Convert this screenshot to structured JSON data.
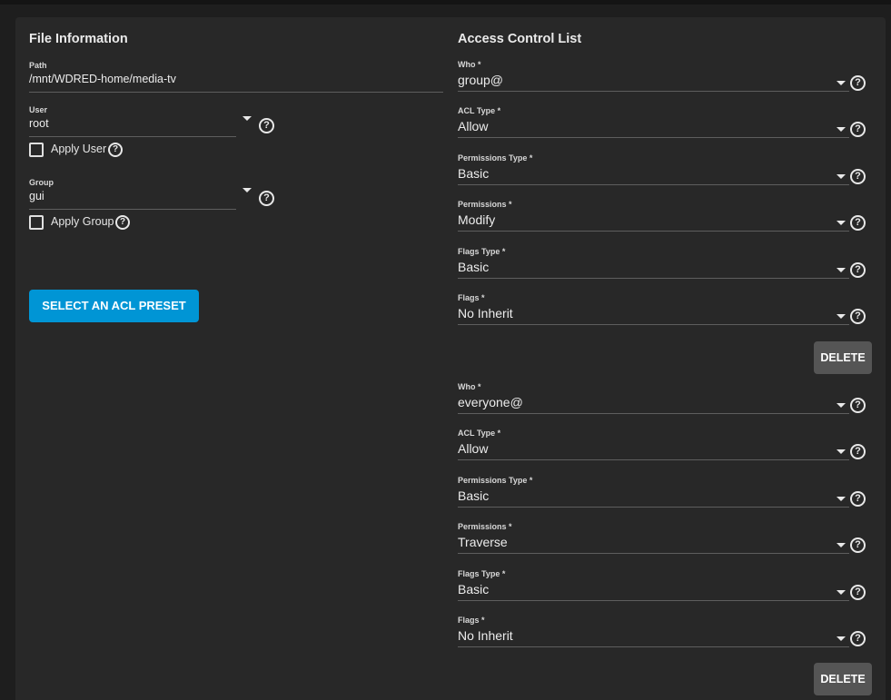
{
  "file_info": {
    "title": "File Information",
    "path": {
      "label": "Path",
      "value": "/mnt/WDRED-home/media-tv"
    },
    "user": {
      "label": "User",
      "value": "root",
      "apply_label": "Apply User"
    },
    "group": {
      "label": "Group",
      "value": "gui",
      "apply_label": "Apply Group"
    },
    "preset_button": "SELECT AN ACL PRESET"
  },
  "acl": {
    "title": "Access Control List",
    "help_glyph": "?",
    "entries": [
      {
        "who": {
          "label": "Who *",
          "value": "group@"
        },
        "acl_type": {
          "label": "ACL Type *",
          "value": "Allow"
        },
        "permissions_type": {
          "label": "Permissions Type *",
          "value": "Basic"
        },
        "permissions": {
          "label": "Permissions *",
          "value": "Modify"
        },
        "flags_type": {
          "label": "Flags Type *",
          "value": "Basic"
        },
        "flags": {
          "label": "Flags *",
          "value": "No Inherit"
        },
        "delete_label": "DELETE"
      },
      {
        "who": {
          "label": "Who *",
          "value": "everyone@"
        },
        "acl_type": {
          "label": "ACL Type *",
          "value": "Allow"
        },
        "permissions_type": {
          "label": "Permissions Type *",
          "value": "Basic"
        },
        "permissions": {
          "label": "Permissions *",
          "value": "Traverse"
        },
        "flags_type": {
          "label": "Flags Type *",
          "value": "Basic"
        },
        "flags": {
          "label": "Flags *",
          "value": "No Inherit"
        },
        "delete_label": "DELETE"
      }
    ]
  },
  "colors": {
    "accent": "#0095d5",
    "card_bg": "#282828",
    "page_bg": "#1e1e1e",
    "delete_bg": "#555555"
  },
  "icons": {
    "help": "help-circle-icon",
    "dropdown": "caret-down-icon",
    "checkbox": "checkbox-unchecked-icon"
  }
}
